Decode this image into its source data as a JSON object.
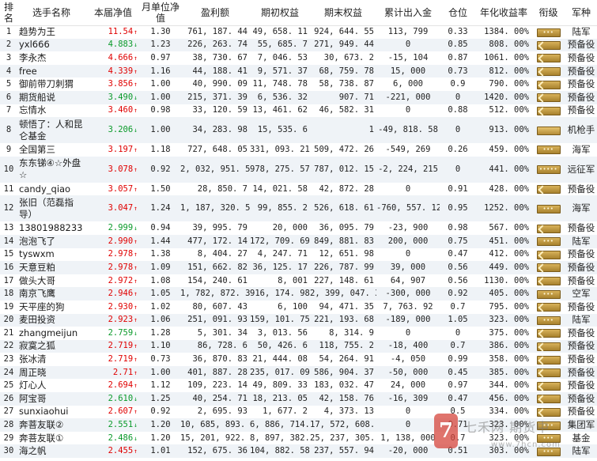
{
  "header": {
    "rank": "排名",
    "name": "选手名称",
    "nav": "本届净值",
    "month_nav": "月单位净值",
    "profit": "盈利额",
    "start_equity": "期初权益",
    "end_equity": "期末权益",
    "flows": "累计出入金",
    "position": "仓位",
    "annual": "年化收益率",
    "rank_badge": "衔级",
    "branch": "军种"
  },
  "colors": {
    "up": "#e00000",
    "down": "#0a9a2a",
    "row_alt": "#eff3f7",
    "badge_gold": "#c8a04a"
  },
  "rows": [
    {
      "rank": "1",
      "name": "趋势为王",
      "nav": "11.54",
      "dir": "up",
      "month": "1.30",
      "profit": "761, 187. 44",
      "start": "49, 658. 11",
      "end": "924, 644. 55",
      "flows": "113, 799",
      "pos": "0.33",
      "annual": "1384. 00%",
      "badge": "3dots",
      "branch": "陆军"
    },
    {
      "rank": "2",
      "name": "yxl666",
      "nav": "4.883",
      "dir": "down",
      "month": "1.23",
      "profit": "226, 263. 74",
      "start": "55, 685. 7",
      "end": "271, 949. 44",
      "flows": "0",
      "pos": "0.85",
      "annual": "808. 00%",
      "badge": "chev",
      "branch": "预备役"
    },
    {
      "rank": "3",
      "name": "李永杰",
      "nav": "4.666",
      "dir": "up",
      "month": "0.97",
      "profit": "38, 730. 67",
      "start": "7, 046. 53",
      "end": "30, 673. 2",
      "flows": "-15, 104",
      "pos": "0.87",
      "annual": "1061. 00%",
      "badge": "chev",
      "branch": "预备役"
    },
    {
      "rank": "4",
      "name": "free",
      "nav": "4.339",
      "dir": "up",
      "month": "1.16",
      "profit": "44, 188. 41",
      "start": "9, 571. 37",
      "end": "68, 759. 78",
      "flows": "15, 000",
      "pos": "0.73",
      "annual": "812. 00%",
      "badge": "chev",
      "branch": "预备役"
    },
    {
      "rank": "5",
      "name": "御前带刀刺猬",
      "nav": "3.856",
      "dir": "up",
      "month": "1.00",
      "profit": "40, 990. 09",
      "start": "11, 748. 78",
      "end": "58, 738. 87",
      "flows": "6, 000",
      "pos": "0.9",
      "annual": "790. 00%",
      "badge": "chev",
      "branch": "预备役"
    },
    {
      "rank": "6",
      "name": "期货船说",
      "nav": "3.490",
      "dir": "down",
      "month": "1.00",
      "profit": "215, 371. 39",
      "start": "6, 536. 32",
      "end": "907. 71",
      "flows": "-221, 000",
      "pos": "0",
      "annual": "1420. 00%",
      "badge": "chev",
      "branch": "预备役"
    },
    {
      "rank": "7",
      "name": "忘情水",
      "nav": "3.460",
      "dir": "up",
      "month": "0.98",
      "profit": "33, 120. 59",
      "start": "13, 461. 62",
      "end": "46, 582. 31",
      "flows": "0",
      "pos": "0.88",
      "annual": "512. 00%",
      "badge": "chev",
      "branch": "预备役"
    },
    {
      "rank": "8",
      "name": "顿悟了：人和昆仑基金",
      "nav": "3.206",
      "dir": "down",
      "month": "1.00",
      "profit": "34, 283. 98",
      "start": "15, 535. 6",
      "end": "1",
      "flows": "-49, 818. 58",
      "pos": "0",
      "annual": "913. 00%",
      "badge": "blank",
      "branch": "机枪手",
      "tall": true
    },
    {
      "rank": "9",
      "name": "全国第三",
      "nav": "3.197",
      "dir": "up",
      "month": "1.18",
      "profit": "727, 648. 05",
      "start": "331, 093. 21",
      "end": "509, 472. 26",
      "flows": "-549, 269",
      "pos": "0.26",
      "annual": "459. 00%",
      "badge": "3dots",
      "branch": "海军"
    },
    {
      "rank": "10",
      "name": "东东锑④☆外盘☆",
      "nav": "3.078",
      "dir": "up",
      "month": "0.92",
      "profit": "2, 032, 951. 58",
      "start": "978, 275. 57",
      "end": "787, 012. 15",
      "flows": "-2, 224, 215",
      "pos": "0",
      "annual": "441. 00%",
      "badge": "5dots",
      "branch": "远征军",
      "tall": true
    },
    {
      "rank": "11",
      "name": "candy_qiao",
      "nav": "3.057",
      "dir": "up",
      "month": "1.50",
      "profit": "28, 850. 7",
      "start": "14, 021. 58",
      "end": "42, 872. 28",
      "flows": "0",
      "pos": "0.91",
      "annual": "428. 00%",
      "badge": "chev",
      "branch": "预备役"
    },
    {
      "rank": "12",
      "name": "张旧（范磊指导）",
      "nav": "3.047",
      "dir": "up",
      "month": "1.24",
      "profit": "1, 187, 320. 53",
      "start": "99, 855. 2",
      "end": "526, 618. 61",
      "flows": "-760, 557. 12",
      "pos": "0.95",
      "annual": "1252. 00%",
      "badge": "3dots",
      "branch": "海军",
      "tall": true
    },
    {
      "rank": "13",
      "name": "13801988233",
      "nav": "2.999",
      "dir": "down",
      "month": "0.94",
      "profit": "39, 995. 79",
      "start": "20, 000",
      "end": "36, 095. 79",
      "flows": "-23, 900",
      "pos": "0.98",
      "annual": "567. 00%",
      "badge": "chev",
      "branch": "预备役"
    },
    {
      "rank": "14",
      "name": "泡泡飞了",
      "nav": "2.990",
      "dir": "up",
      "month": "1.44",
      "profit": "477, 172. 14",
      "start": "172, 709. 69",
      "end": "849, 881. 83",
      "flows": "200, 000",
      "pos": "0.75",
      "annual": "451. 00%",
      "badge": "3dots",
      "branch": "陆军"
    },
    {
      "rank": "15",
      "name": "tyswxm",
      "nav": "2.978",
      "dir": "up",
      "month": "1.38",
      "profit": "8, 404. 27",
      "start": "4, 247. 71",
      "end": "12, 651. 98",
      "flows": "0",
      "pos": "0.47",
      "annual": "412. 00%",
      "badge": "chev",
      "branch": "预备役"
    },
    {
      "rank": "16",
      "name": "天意豆粕",
      "nav": "2.978",
      "dir": "up",
      "month": "1.09",
      "profit": "151, 662. 82",
      "start": "36, 125. 17",
      "end": "226, 787. 99",
      "flows": "39, 000",
      "pos": "0.56",
      "annual": "449. 00%",
      "badge": "chev",
      "branch": "预备役"
    },
    {
      "rank": "17",
      "name": "做头大哥",
      "nav": "2.972",
      "dir": "up",
      "month": "1.08",
      "profit": "154, 240. 61",
      "start": "8, 001",
      "end": "227, 148. 61",
      "flows": "64, 907",
      "pos": "0.56",
      "annual": "1130. 00%",
      "badge": "chev",
      "branch": "预备役"
    },
    {
      "rank": "18",
      "name": "南京飞鹰",
      "nav": "2.946",
      "dir": "up",
      "month": "1.05",
      "profit": "1, 782, 872. 38",
      "start": "916, 174. 98",
      "end": "2, 399, 047. 36",
      "flows": "-300, 000",
      "pos": "0.92",
      "annual": "405. 00%",
      "badge": "3dots",
      "branch": "空军"
    },
    {
      "rank": "19",
      "name": "天平座的狗",
      "nav": "2.930",
      "dir": "up",
      "month": "1.02",
      "profit": "80, 607. 43",
      "start": "6, 100",
      "end": "94, 471. 35",
      "flows": "7, 763. 92",
      "pos": "0.7",
      "annual": "795. 00%",
      "badge": "chev",
      "branch": "预备役"
    },
    {
      "rank": "20",
      "name": "麦田投资",
      "nav": "2.923",
      "dir": "up",
      "month": "1.06",
      "profit": "251, 091. 93",
      "start": "159, 101. 75",
      "end": "221, 193. 68",
      "flows": "-189, 000",
      "pos": "1.05",
      "annual": "323. 00%",
      "badge": "3dots",
      "branch": "陆军"
    },
    {
      "rank": "21",
      "name": "zhangmeijun",
      "nav": "2.759",
      "dir": "down",
      "month": "1.28",
      "profit": "5, 301. 34",
      "start": "3, 013. 56",
      "end": "8, 314. 9",
      "flows": "0",
      "pos": "0",
      "annual": "375. 00%",
      "badge": "chev",
      "branch": "预备役"
    },
    {
      "rank": "22",
      "name": "寂寞之狐",
      "nav": "2.719",
      "dir": "up",
      "month": "1.10",
      "profit": "86, 728. 6",
      "start": "50, 426. 6",
      "end": "118, 755. 2",
      "flows": "-18, 400",
      "pos": "0.7",
      "annual": "386. 00%",
      "badge": "chev",
      "branch": "预备役"
    },
    {
      "rank": "23",
      "name": "张冰清",
      "nav": "2.719",
      "dir": "up",
      "month": "0.73",
      "profit": "36, 870. 83",
      "start": "21, 444. 08",
      "end": "54, 264. 91",
      "flows": "-4, 050",
      "pos": "0.99",
      "annual": "358. 00%",
      "badge": "chev",
      "branch": "预备役"
    },
    {
      "rank": "24",
      "name": "周正晓",
      "nav": "2.71",
      "dir": "up",
      "month": "1.00",
      "profit": "401, 887. 28",
      "start": "235, 017. 09",
      "end": "586, 904. 37",
      "flows": "-50, 000",
      "pos": "0.45",
      "annual": "385. 00%",
      "badge": "chev",
      "branch": "预备役"
    },
    {
      "rank": "25",
      "name": "灯心人",
      "nav": "2.694",
      "dir": "up",
      "month": "1.12",
      "profit": "109, 223. 14",
      "start": "49, 809. 33",
      "end": "183, 032. 47",
      "flows": "24, 000",
      "pos": "0.97",
      "annual": "344. 00%",
      "badge": "chev",
      "branch": "预备役"
    },
    {
      "rank": "26",
      "name": "阿宝哥",
      "nav": "2.610",
      "dir": "down",
      "month": "1.25",
      "profit": "40, 254. 71",
      "start": "18, 213. 05",
      "end": "42, 158. 76",
      "flows": "-16, 309",
      "pos": "0.47",
      "annual": "456. 00%",
      "badge": "chev",
      "branch": "预备役"
    },
    {
      "rank": "27",
      "name": "sunxiaohui",
      "nav": "2.607",
      "dir": "up",
      "month": "0.92",
      "profit": "2, 695. 93",
      "start": "1, 677. 2",
      "end": "4, 373. 13",
      "flows": "0",
      "pos": "0.5",
      "annual": "334. 00%",
      "badge": "chev",
      "branch": "预备役"
    },
    {
      "rank": "28",
      "name": "奔菩友联②",
      "nav": "2.551",
      "dir": "down",
      "month": "1.20",
      "profit": "10, 685, 893. 96",
      "start": "6, 886, 714. 55",
      "end": "17, 572, 608. 51",
      "flows": "0",
      "pos": "0.71",
      "annual": "323. 00%",
      "badge": "3dots",
      "branch": "集团军"
    },
    {
      "rank": "29",
      "name": "奔菩友联①",
      "nav": "2.486",
      "dir": "down",
      "month": "1.20",
      "profit": "15, 201, 922. 24",
      "start": "8, 897, 382. 77",
      "end": "25, 237, 305. 01",
      "flows": "1, 138, 000",
      "pos": "0.7",
      "annual": "323. 00%",
      "badge": "3dots",
      "branch": "基金"
    },
    {
      "rank": "30",
      "name": "海之帆",
      "nav": "2.455",
      "dir": "up",
      "month": "1.01",
      "profit": "152, 675. 36",
      "start": "104, 882. 58",
      "end": "237, 557. 94",
      "flows": "-20, 000",
      "pos": "0.51",
      "annual": "303. 00%",
      "badge": "3dots",
      "branch": "陆军"
    }
  ],
  "watermark": {
    "logo": "7",
    "line1": "七禾网 期货中",
    "line2": "www.7hcn.com"
  }
}
